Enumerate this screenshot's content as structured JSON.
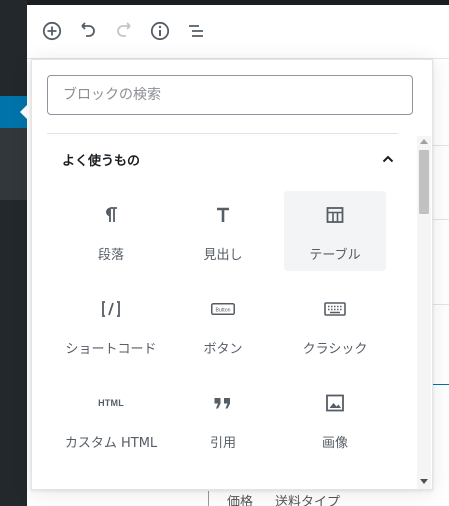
{
  "toolbar": {
    "buttons": [
      {
        "name": "add-block",
        "icon": "plus-circle-icon"
      },
      {
        "name": "undo",
        "icon": "undo-icon"
      },
      {
        "name": "redo",
        "icon": "redo-icon"
      },
      {
        "name": "info",
        "icon": "info-icon"
      },
      {
        "name": "block-navigation",
        "icon": "list-icon"
      }
    ]
  },
  "inserter": {
    "search": {
      "placeholder": "ブロックの検索",
      "value": ""
    },
    "panel": {
      "title": "よく使うもの",
      "expanded": true
    },
    "blocks": [
      {
        "label": "段落",
        "icon": "paragraph-icon"
      },
      {
        "label": "見出し",
        "icon": "heading-icon"
      },
      {
        "label": "テーブル",
        "icon": "table-icon"
      },
      {
        "label": "ショートコード",
        "icon": "shortcode-icon"
      },
      {
        "label": "ボタン",
        "icon": "button-icon"
      },
      {
        "label": "クラシック",
        "icon": "keyboard-icon"
      },
      {
        "label": "カスタム HTML",
        "icon": "html-icon"
      },
      {
        "label": "引用",
        "icon": "quote-icon"
      },
      {
        "label": "画像",
        "icon": "image-icon"
      }
    ],
    "hovered_block": "テーブル",
    "button_icon_text": "Button",
    "html_icon_text": "HTML"
  },
  "background": {
    "fragment_left": "価格",
    "fragment_right": "送料タイプ"
  },
  "colors": {
    "admin_bar": "#23282d",
    "accent": "#0073aa"
  }
}
